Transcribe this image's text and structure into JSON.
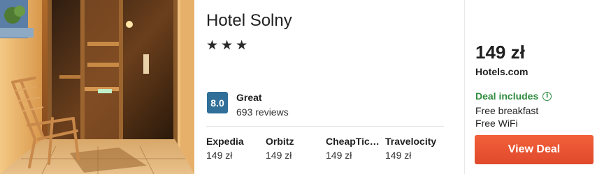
{
  "hotel": {
    "name": "Hotel Solny",
    "stars": 3,
    "stars_display": "★★★",
    "rating": {
      "score": "8.0",
      "label": "Great",
      "reviews": "693 reviews",
      "badge_color": "#2f6f98"
    }
  },
  "providers": [
    {
      "name": "Expedia",
      "price": "149 zł"
    },
    {
      "name": "Orbitz",
      "price": "149 zł"
    },
    {
      "name": "CheapTic…",
      "price": "149 zł"
    },
    {
      "name": "Travelocity",
      "price": "149 zł"
    }
  ],
  "deal": {
    "price": "149 zł",
    "provider": "Hotels.com",
    "includes_label": "Deal includes",
    "includes_icon": "info-icon",
    "perks": [
      "Free breakfast",
      "Free WiFi"
    ],
    "button_label": "View Deal",
    "button_color": "#e8512f",
    "includes_color": "#2e8b3e"
  },
  "image": {
    "subject": "sauna-room-photo"
  }
}
